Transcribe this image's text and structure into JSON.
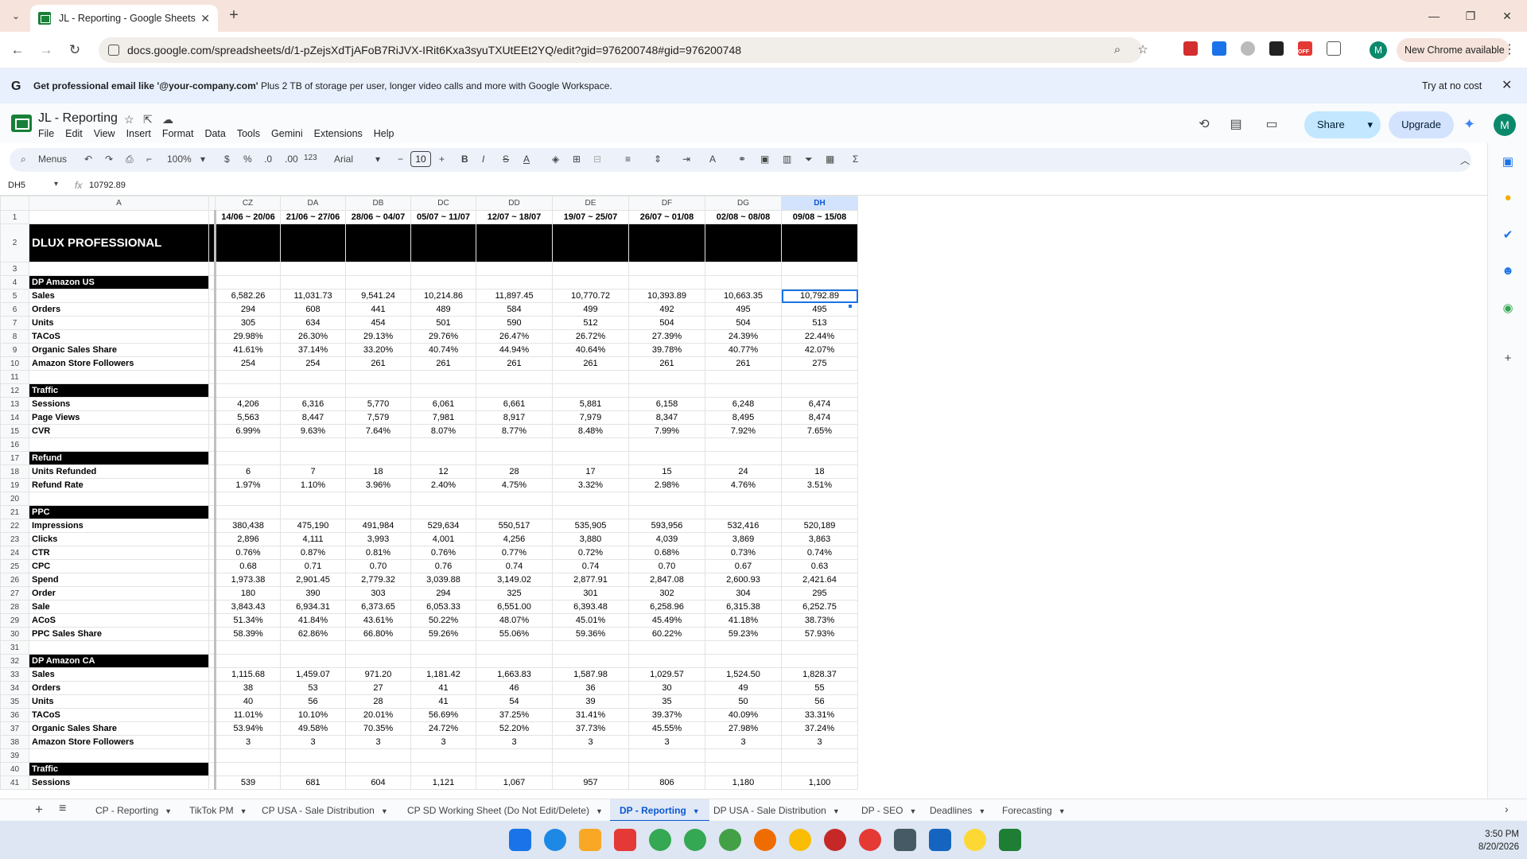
{
  "browser": {
    "tab_title": "JL - Reporting - Google Sheets",
    "url": "docs.google.com/spreadsheets/d/1-pZejsXdTjAFoB7RiJVX-IRit6Kxa3syuTXUtEEt2YQ/edit?gid=976200748#gid=976200748",
    "profile_initial": "M",
    "new_chrome_label": "New Chrome available",
    "extension_badge": "OFF"
  },
  "banner": {
    "message_bold": "Get professional email like '@your-company.com'",
    "message_rest": "Plus 2 TB of storage per user, longer video calls and more with Google Workspace.",
    "cta": "Try at no cost"
  },
  "sheets": {
    "title": "JL - Reporting",
    "menu": [
      "File",
      "Edit",
      "View",
      "Insert",
      "Format",
      "Data",
      "Tools",
      "Gemini",
      "Extensions",
      "Help"
    ],
    "share_label": "Share",
    "upgrade_label": "Upgrade",
    "avatar_initial": "M"
  },
  "toolbar": {
    "menus_label": "Menus",
    "zoom": "100%",
    "currency": "$",
    "percent": "%",
    "dec_less": ".0",
    "dec_more": ".00",
    "number_format": "123",
    "font": "Arial",
    "font_size": "10"
  },
  "formula_bar": {
    "cell_ref": "DH5",
    "fx_symbol": "fx",
    "value": "10792.89"
  },
  "grid": {
    "column_a": "A",
    "columns": [
      "CZ",
      "DA",
      "DB",
      "DC",
      "DD",
      "DE",
      "DF",
      "DG",
      "DH"
    ],
    "weeks": [
      "14/06 ~ 20/06",
      "21/06 ~ 27/06",
      "28/06 ~ 04/07",
      "05/07 ~ 11/07",
      "12/07 ~ 18/07",
      "19/07 ~ 25/07",
      "26/07 ~ 01/08",
      "02/08 ~ 08/08",
      "09/08 ~ 15/08"
    ],
    "title": "DLUX PROFESSIONAL",
    "rows": [
      {
        "n": "3",
        "type": "blank",
        "label": "",
        "values": []
      },
      {
        "n": "4",
        "type": "section",
        "label": "DP Amazon US",
        "values": []
      },
      {
        "n": "5",
        "type": "data",
        "label": "Sales",
        "values": [
          "6,582.26",
          "11,031.73",
          "9,541.24",
          "10,214.86",
          "11,897.45",
          "10,770.72",
          "10,393.89",
          "10,663.35",
          "10,792.89"
        ]
      },
      {
        "n": "6",
        "type": "data",
        "label": "Orders",
        "values": [
          "294",
          "608",
          "441",
          "489",
          "584",
          "499",
          "492",
          "495",
          "495"
        ]
      },
      {
        "n": "7",
        "type": "data",
        "label": "Units",
        "values": [
          "305",
          "634",
          "454",
          "501",
          "590",
          "512",
          "504",
          "504",
          "513"
        ]
      },
      {
        "n": "8",
        "type": "data",
        "label": "TACoS",
        "values": [
          "29.98%",
          "26.30%",
          "29.13%",
          "29.76%",
          "26.47%",
          "26.72%",
          "27.39%",
          "24.39%",
          "22.44%"
        ]
      },
      {
        "n": "9",
        "type": "data",
        "label": "Organic Sales Share",
        "values": [
          "41.61%",
          "37.14%",
          "33.20%",
          "40.74%",
          "44.94%",
          "40.64%",
          "39.78%",
          "40.77%",
          "42.07%"
        ]
      },
      {
        "n": "10",
        "type": "data",
        "label": "Amazon Store Followers",
        "values": [
          "254",
          "254",
          "261",
          "261",
          "261",
          "261",
          "261",
          "261",
          "275"
        ]
      },
      {
        "n": "11",
        "type": "blank",
        "label": "",
        "values": []
      },
      {
        "n": "12",
        "type": "section",
        "label": "Traffic",
        "values": []
      },
      {
        "n": "13",
        "type": "data",
        "label": "Sessions",
        "values": [
          "4,206",
          "6,316",
          "5,770",
          "6,061",
          "6,661",
          "5,881",
          "6,158",
          "6,248",
          "6,474"
        ]
      },
      {
        "n": "14",
        "type": "data",
        "label": "Page Views",
        "values": [
          "5,563",
          "8,447",
          "7,579",
          "7,981",
          "8,917",
          "7,979",
          "8,347",
          "8,495",
          "8,474"
        ]
      },
      {
        "n": "15",
        "type": "data",
        "label": "CVR",
        "values": [
          "6.99%",
          "9.63%",
          "7.64%",
          "8.07%",
          "8.77%",
          "8.48%",
          "7.99%",
          "7.92%",
          "7.65%"
        ]
      },
      {
        "n": "16",
        "type": "blank",
        "label": "",
        "values": []
      },
      {
        "n": "17",
        "type": "section",
        "label": "Refund",
        "values": []
      },
      {
        "n": "18",
        "type": "data",
        "label": "Units Refunded",
        "values": [
          "6",
          "7",
          "18",
          "12",
          "28",
          "17",
          "15",
          "24",
          "18"
        ]
      },
      {
        "n": "19",
        "type": "data",
        "label": "Refund Rate",
        "values": [
          "1.97%",
          "1.10%",
          "3.96%",
          "2.40%",
          "4.75%",
          "3.32%",
          "2.98%",
          "4.76%",
          "3.51%"
        ]
      },
      {
        "n": "20",
        "type": "blank",
        "label": "",
        "values": []
      },
      {
        "n": "21",
        "type": "section",
        "label": "PPC",
        "values": []
      },
      {
        "n": "22",
        "type": "data",
        "label": "Impressions",
        "values": [
          "380,438",
          "475,190",
          "491,984",
          "529,634",
          "550,517",
          "535,905",
          "593,956",
          "532,416",
          "520,189"
        ]
      },
      {
        "n": "23",
        "type": "data",
        "label": "Clicks",
        "values": [
          "2,896",
          "4,111",
          "3,993",
          "4,001",
          "4,256",
          "3,880",
          "4,039",
          "3,869",
          "3,863"
        ]
      },
      {
        "n": "24",
        "type": "data",
        "label": "CTR",
        "values": [
          "0.76%",
          "0.87%",
          "0.81%",
          "0.76%",
          "0.77%",
          "0.72%",
          "0.68%",
          "0.73%",
          "0.74%"
        ]
      },
      {
        "n": "25",
        "type": "data",
        "label": "CPC",
        "values": [
          "0.68",
          "0.71",
          "0.70",
          "0.76",
          "0.74",
          "0.74",
          "0.70",
          "0.67",
          "0.63"
        ]
      },
      {
        "n": "26",
        "type": "data",
        "label": "Spend",
        "values": [
          "1,973.38",
          "2,901.45",
          "2,779.32",
          "3,039.88",
          "3,149.02",
          "2,877.91",
          "2,847.08",
          "2,600.93",
          "2,421.64"
        ]
      },
      {
        "n": "27",
        "type": "data",
        "label": "Order",
        "values": [
          "180",
          "390",
          "303",
          "294",
          "325",
          "301",
          "302",
          "304",
          "295"
        ]
      },
      {
        "n": "28",
        "type": "data",
        "label": "Sale",
        "values": [
          "3,843.43",
          "6,934.31",
          "6,373.65",
          "6,053.33",
          "6,551.00",
          "6,393.48",
          "6,258.96",
          "6,315.38",
          "6,252.75"
        ]
      },
      {
        "n": "29",
        "type": "data",
        "label": "ACoS",
        "values": [
          "51.34%",
          "41.84%",
          "43.61%",
          "50.22%",
          "48.07%",
          "45.01%",
          "45.49%",
          "41.18%",
          "38.73%"
        ]
      },
      {
        "n": "30",
        "type": "data",
        "label": "PPC Sales Share",
        "values": [
          "58.39%",
          "62.86%",
          "66.80%",
          "59.26%",
          "55.06%",
          "59.36%",
          "60.22%",
          "59.23%",
          "57.93%"
        ]
      },
      {
        "n": "31",
        "type": "blank",
        "label": "",
        "values": []
      },
      {
        "n": "32",
        "type": "section",
        "label": "DP Amazon CA",
        "values": []
      },
      {
        "n": "33",
        "type": "data",
        "label": "Sales",
        "values": [
          "1,115.68",
          "1,459.07",
          "971.20",
          "1,181.42",
          "1,663.83",
          "1,587.98",
          "1,029.57",
          "1,524.50",
          "1,828.37"
        ]
      },
      {
        "n": "34",
        "type": "data",
        "label": "Orders",
        "values": [
          "38",
          "53",
          "27",
          "41",
          "46",
          "36",
          "30",
          "49",
          "55"
        ]
      },
      {
        "n": "35",
        "type": "data",
        "label": "Units",
        "values": [
          "40",
          "56",
          "28",
          "41",
          "54",
          "39",
          "35",
          "50",
          "56"
        ]
      },
      {
        "n": "36",
        "type": "data",
        "label": "TACoS",
        "values": [
          "11.01%",
          "10.10%",
          "20.01%",
          "56.69%",
          "37.25%",
          "31.41%",
          "39.37%",
          "40.09%",
          "33.31%"
        ]
      },
      {
        "n": "37",
        "type": "data",
        "label": "Organic Sales Share",
        "values": [
          "53.94%",
          "49.58%",
          "70.35%",
          "24.72%",
          "52.20%",
          "37.73%",
          "45.55%",
          "27.98%",
          "37.24%"
        ]
      },
      {
        "n": "38",
        "type": "data",
        "label": "Amazon Store Followers",
        "values": [
          "3",
          "3",
          "3",
          "3",
          "3",
          "3",
          "3",
          "3",
          "3"
        ]
      },
      {
        "n": "39",
        "type": "blank",
        "label": "",
        "values": []
      },
      {
        "n": "40",
        "type": "section",
        "label": "Traffic",
        "values": []
      },
      {
        "n": "41",
        "type": "data",
        "label": "Sessions",
        "values": [
          "539",
          "681",
          "604",
          "1,121",
          "1,067",
          "957",
          "806",
          "1,180",
          "1,100"
        ]
      }
    ]
  },
  "sheet_tabs": [
    {
      "label": "CP - Reporting",
      "active": false
    },
    {
      "label": "TikTok PM",
      "active": false
    },
    {
      "label": "CP USA - Sale Distribution",
      "active": false
    },
    {
      "label": "CP SD Working Sheet (Do Not Edit/Delete)",
      "active": false
    },
    {
      "label": "DP - Reporting",
      "active": true
    },
    {
      "label": "DP USA - Sale Distribution",
      "active": false
    },
    {
      "label": "DP - SEO",
      "active": false
    },
    {
      "label": "Deadlines",
      "active": false
    },
    {
      "label": "Forecasting",
      "active": false
    }
  ],
  "taskbar": {
    "time": "3:50 PM",
    "date": "8/20/2026"
  }
}
